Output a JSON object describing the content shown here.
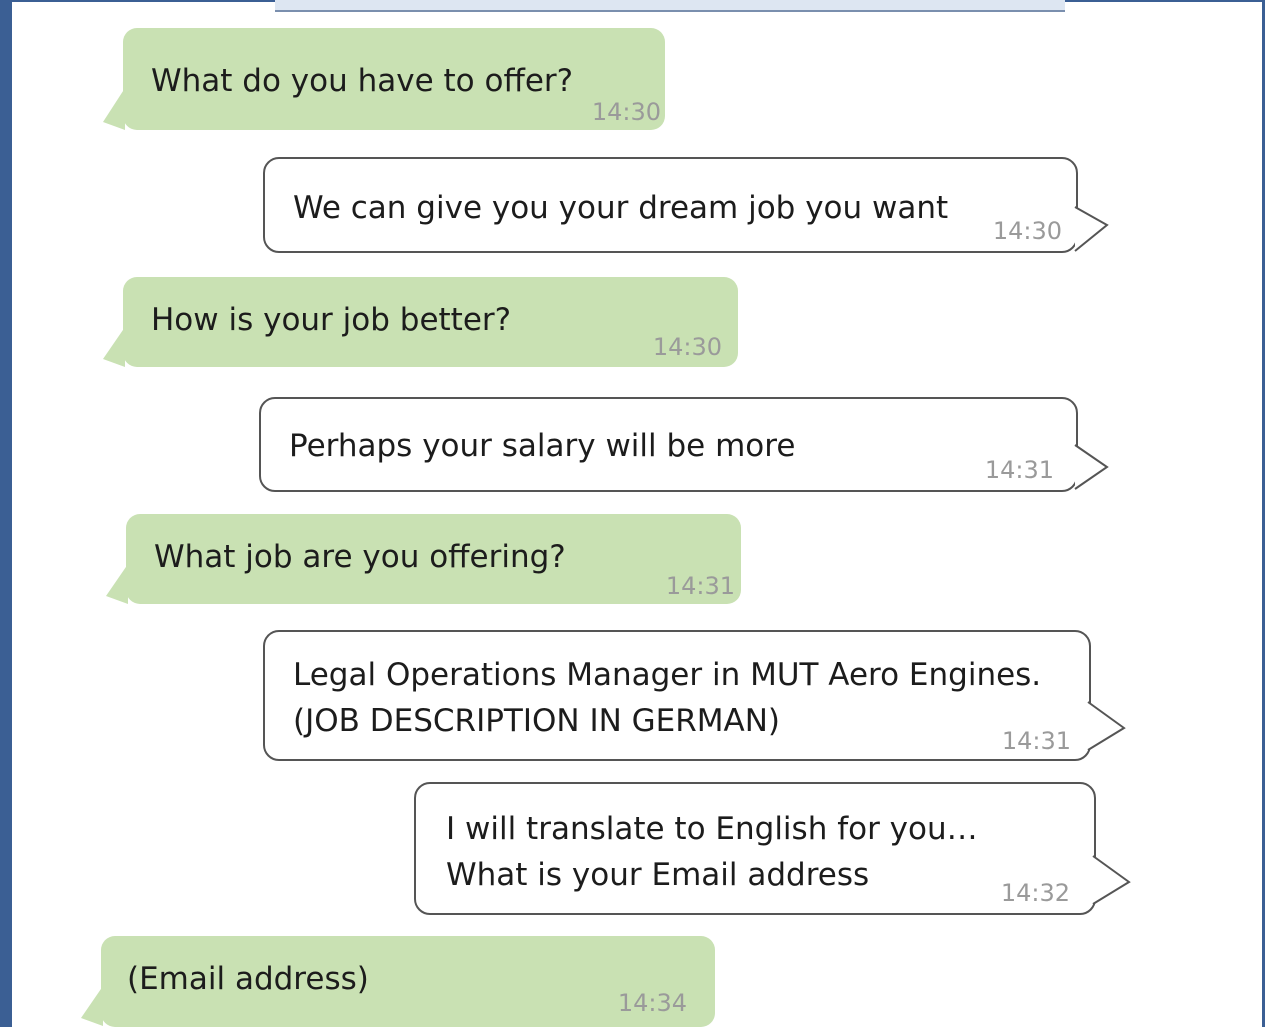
{
  "messages": [
    {
      "direction": "incoming",
      "text": "What do you have to offer?",
      "time": "14:30"
    },
    {
      "direction": "outgoing",
      "text": "We can give you your dream job you want",
      "time": "14:30"
    },
    {
      "direction": "incoming",
      "text": "How is your job better?",
      "time": "14:30"
    },
    {
      "direction": "outgoing",
      "text": "Perhaps your salary will be more",
      "time": "14:31"
    },
    {
      "direction": "incoming",
      "text": "What job are you offering?",
      "time": "14:31"
    },
    {
      "direction": "outgoing",
      "text": "Legal Operations Manager in MUT Aero Engines.\n(JOB DESCRIPTION IN GERMAN)",
      "time": "14:31"
    },
    {
      "direction": "outgoing",
      "text": "I will translate to English for you…\nWhat is your Email address",
      "time": "14:32"
    },
    {
      "direction": "incoming",
      "text": "(Email address)",
      "time": "14:34"
    }
  ],
  "colors": {
    "incoming_bubble": "#c9e1b3",
    "outgoing_bubble": "#ffffff",
    "frame_border": "#3b5f94",
    "timestamp": "#9a9a9a"
  }
}
